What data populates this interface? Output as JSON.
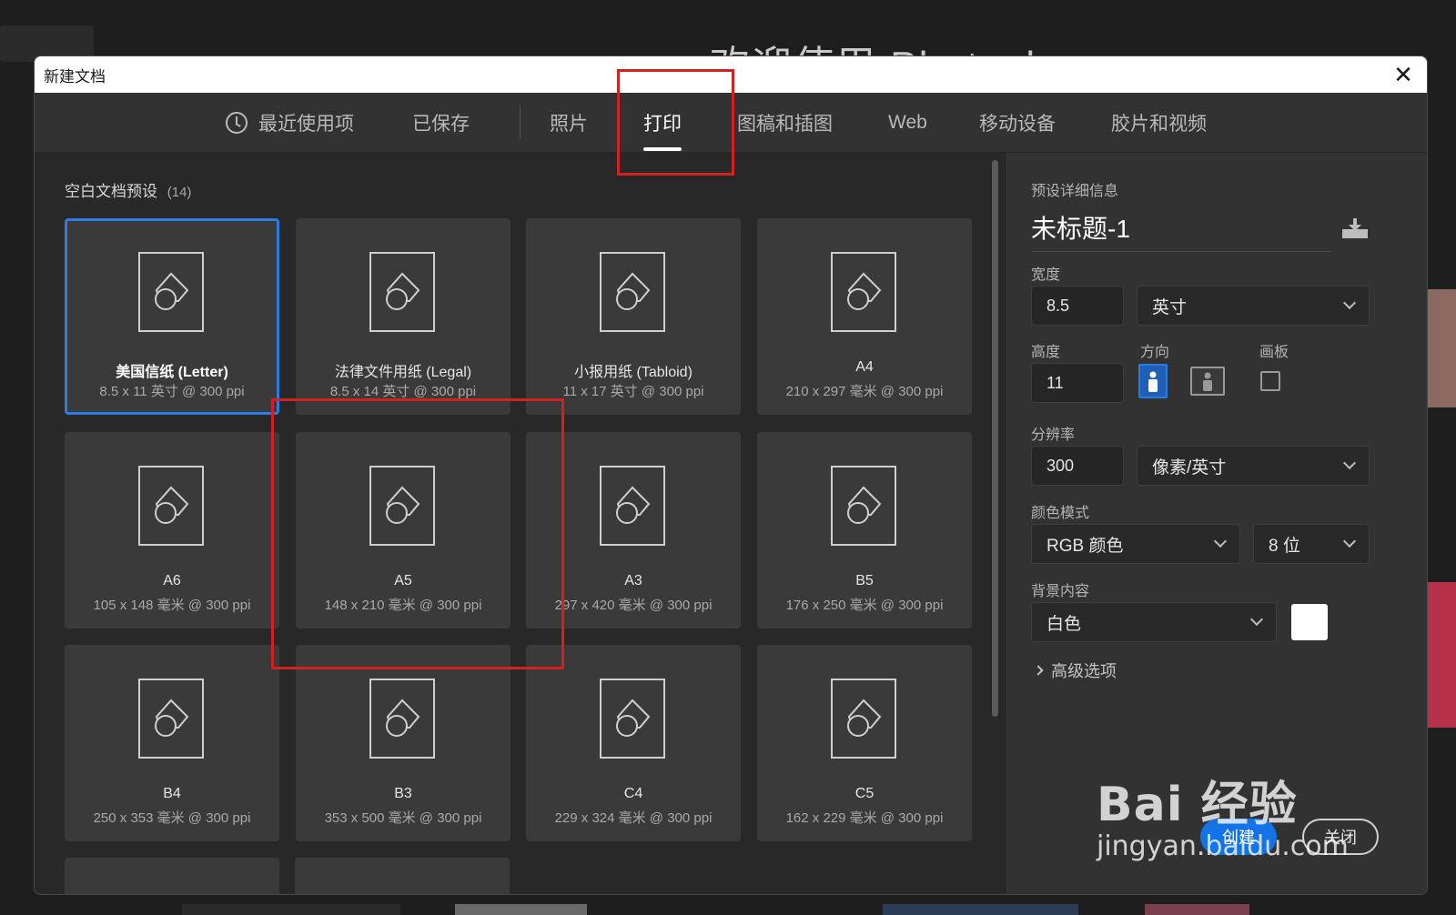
{
  "background": {
    "welcome_text": "欢迎使用 Photoshop"
  },
  "dialog": {
    "title": "新建文档",
    "close_symbol": "✕"
  },
  "tabs": [
    {
      "label": "最近使用项",
      "icon": "clock-icon"
    },
    {
      "label": "已保存"
    },
    {
      "label": "照片"
    },
    {
      "label": "打印",
      "active": true
    },
    {
      "label": "图稿和插图"
    },
    {
      "label": "Web"
    },
    {
      "label": "移动设备"
    },
    {
      "label": "胶片和视频"
    }
  ],
  "presets": {
    "section_title": "空白文档预设",
    "count": "(14)",
    "items": [
      {
        "name": "美国信纸 (Letter)",
        "spec": "8.5 x 11 英寸 @ 300 ppi",
        "selected": true
      },
      {
        "name": "法律文件用纸 (Legal)",
        "spec": "8.5 x 14 英寸 @ 300 ppi"
      },
      {
        "name": "小报用纸 (Tabloid)",
        "spec": "11 x 17 英寸 @ 300 ppi"
      },
      {
        "name": "A4",
        "spec": "210 x 297 毫米 @ 300 ppi"
      },
      {
        "name": "A6",
        "spec": "105 x 148 毫米 @ 300 ppi"
      },
      {
        "name": "A5",
        "spec": "148 x 210 毫米 @ 300 ppi"
      },
      {
        "name": "A3",
        "spec": "297 x 420 毫米 @ 300 ppi"
      },
      {
        "name": "B5",
        "spec": "176 x 250 毫米 @ 300 ppi"
      },
      {
        "name": "B4",
        "spec": "250 x 353 毫米 @ 300 ppi"
      },
      {
        "name": "B3",
        "spec": "353 x 500 毫米 @ 300 ppi"
      },
      {
        "name": "C4",
        "spec": "229 x 324 毫米 @ 300 ppi"
      },
      {
        "name": "C5",
        "spec": "162 x 229 毫米 @ 300 ppi"
      }
    ]
  },
  "details": {
    "header": "预设详细信息",
    "doc_name": "未标题-1",
    "width_label": "宽度",
    "width_value": "8.5",
    "width_unit": "英寸",
    "height_label": "高度",
    "height_value": "11",
    "orientation_label": "方向",
    "artboard_label": "画板",
    "resolution_label": "分辨率",
    "resolution_value": "300",
    "resolution_unit": "像素/英寸",
    "color_mode_label": "颜色模式",
    "color_mode_value": "RGB 颜色",
    "bit_depth_value": "8 位",
    "background_label": "背景内容",
    "background_value": "白色",
    "background_swatch_color": "#ffffff",
    "advanced_label": "高级选项",
    "create_button": "创建",
    "close_button": "关闭"
  },
  "watermark": {
    "brand": "Bai 经验",
    "url": "jingyan.baidu.com"
  },
  "colors": {
    "accent_blue": "#2c7be5",
    "highlight_red": "#d32020",
    "dialog_bg": "#2b2b2b"
  }
}
